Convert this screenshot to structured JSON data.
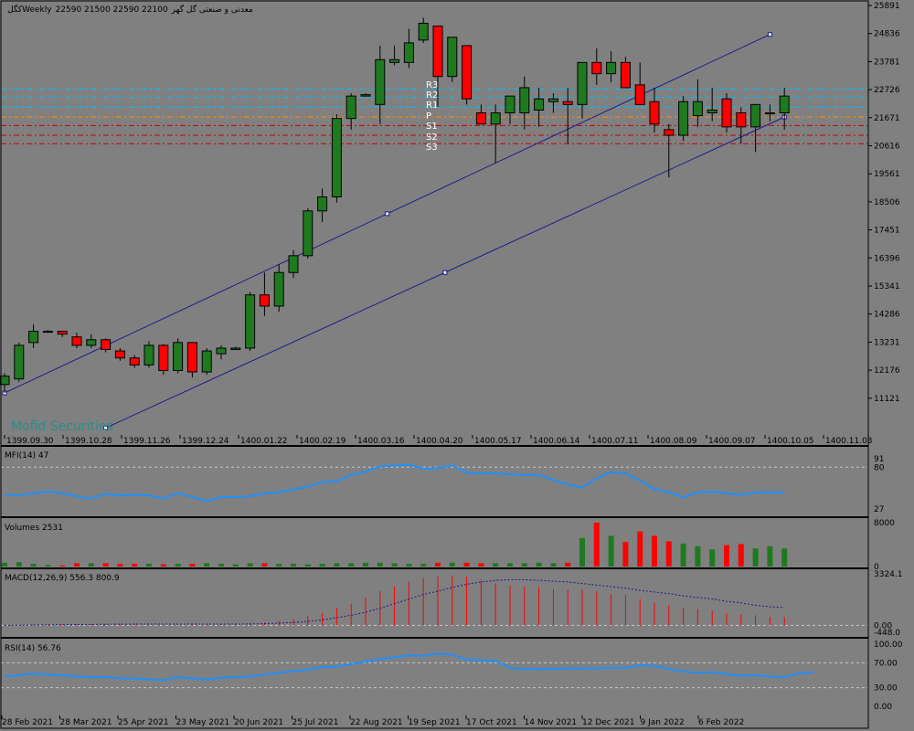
{
  "header": {
    "symbol": "کگل",
    "timeframe": "Weekly",
    "ohlc": "22590 21500 22590 22100",
    "description": "معدنی و صنعتی گل گهر"
  },
  "watermark": "Mofid Securities",
  "colors": {
    "background": "#808080",
    "bull": "#1F7A1F",
    "bear": "#FF0000",
    "channel": "#1A1A8C",
    "pivot_r": "#00BFFF",
    "pivot_s": "#CC0000",
    "pivot_p": "#FF8C00",
    "indicator": "#1E90FF",
    "text": "#000000",
    "pivot_text": "#FFFFFF"
  },
  "main_ticks": [
    "25891",
    "24836",
    "23781",
    "22726",
    "21671",
    "20616",
    "19561",
    "18506",
    "17451",
    "16396",
    "15341",
    "14286",
    "13231",
    "12176",
    "11121"
  ],
  "main_dates": [
    "1399.09.30",
    "1399.10.28",
    "1399.11.26",
    "1399.12.24",
    "1400.01.22",
    "1400.02.19",
    "1400.03.16",
    "1400.04.20",
    "1400.05.17",
    "1400.06.14",
    "1400.07.11",
    "1400.08.09",
    "1400.09.07",
    "1400.10.05",
    "1400.11.03"
  ],
  "bottom_dates": [
    "28 Feb 2021",
    "28 Mar 2021",
    "25 Apr 2021",
    "23 May 2021",
    "20 Jun 2021",
    "25 Jul 2021",
    "22 Aug 2021",
    "19 Sep 2021",
    "17 Oct 2021",
    "14 Nov 2021",
    "12 Dec 2021",
    "9 Jan 2022",
    "6 Feb 2022"
  ],
  "pivot_labels": [
    "R3",
    "R2",
    "R1",
    "P",
    "S1",
    "S2",
    "S3"
  ],
  "mfi": {
    "label": "MFI(14) 47",
    "ticks": [
      "91",
      "80",
      "27"
    ]
  },
  "volumes": {
    "label": "Volumes 2531",
    "ticks": [
      "8000",
      "0"
    ]
  },
  "macd": {
    "label": "MACD(12,26,9) 556.3 800.9",
    "ticks": [
      "3324.1",
      "0.00",
      "-448.0"
    ]
  },
  "rsi": {
    "label": "RSI(14) 56.76",
    "ticks": [
      "100.00",
      "70.00",
      "30.00",
      "0.00"
    ]
  },
  "chart_data": [
    {
      "type": "candlestick",
      "ylim": [
        10700,
        26100
      ],
      "candles": [
        [
          12500,
          12900,
          12200,
          12800
        ],
        [
          12700,
          14000,
          12600,
          13900
        ],
        [
          14000,
          14650,
          13800,
          14400
        ],
        [
          14400,
          14450,
          14350,
          14400
        ],
        [
          14400,
          14300,
          14200,
          14300
        ],
        [
          14200,
          14350,
          13800,
          13900
        ],
        [
          13900,
          14300,
          13800,
          14100
        ],
        [
          14100,
          14150,
          13650,
          13750
        ],
        [
          13700,
          13800,
          13350,
          13450
        ],
        [
          13450,
          13550,
          13100,
          13200
        ],
        [
          13200,
          14050,
          13100,
          13900
        ],
        [
          13900,
          13950,
          12850,
          13000
        ],
        [
          13000,
          14150,
          12900,
          14000
        ],
        [
          14000,
          14000,
          12750,
          12950
        ],
        [
          12950,
          13800,
          12850,
          13700
        ],
        [
          13600,
          13900,
          13400,
          13800
        ],
        [
          13750,
          13850,
          13750,
          13800
        ],
        [
          13800,
          15800,
          13700,
          15700
        ],
        [
          15700,
          16500,
          14950,
          15300
        ],
        [
          15300,
          16800,
          15100,
          16500
        ],
        [
          16500,
          17300,
          16300,
          17100
        ],
        [
          17100,
          18800,
          17000,
          18700
        ],
        [
          18700,
          19500,
          18300,
          19200
        ],
        [
          19200,
          22150,
          19000,
          22000
        ],
        [
          22000,
          22900,
          21600,
          22800
        ],
        [
          22800,
          22900,
          22800,
          22850
        ],
        [
          22500,
          24600,
          21800,
          24100
        ],
        [
          24000,
          24600,
          23900,
          24100
        ],
        [
          24000,
          25200,
          23800,
          24700
        ],
        [
          24800,
          25600,
          24700,
          25400
        ],
        [
          25300,
          25300,
          22400,
          23500
        ],
        [
          23500,
          24900,
          23300,
          24900
        ],
        [
          24600,
          24600,
          22500,
          22700
        ],
        [
          22200,
          22500,
          21900,
          21800
        ],
        [
          21800,
          22500,
          20400,
          22200
        ],
        [
          22200,
          22700,
          21800,
          22800
        ],
        [
          22200,
          23500,
          21600,
          23100
        ],
        [
          22300,
          23100,
          21700,
          22700
        ],
        [
          22600,
          22900,
          22200,
          22700
        ],
        [
          22600,
          23100,
          21100,
          22500
        ],
        [
          22500,
          24000,
          22000,
          24000
        ],
        [
          24000,
          24500,
          23200,
          23600
        ],
        [
          23600,
          24400,
          23300,
          24000
        ],
        [
          24000,
          24200,
          23300,
          23100
        ],
        [
          23200,
          24000,
          22600,
          22500
        ],
        [
          22600,
          23100,
          21500,
          21800
        ],
        [
          21600,
          21800,
          19900,
          21400
        ],
        [
          21400,
          22800,
          21200,
          22600
        ],
        [
          22100,
          23400,
          21700,
          22600
        ],
        [
          22200,
          23100,
          21900,
          22300
        ],
        [
          22700,
          22900,
          21500,
          21700
        ],
        [
          22200,
          22400,
          21100,
          21700
        ],
        [
          21700,
          22500,
          20800,
          22500
        ],
        [
          22200,
          22500,
          21900,
          22200
        ],
        [
          22200,
          23100,
          21600,
          22800
        ]
      ],
      "pivots": {
        "R3": 23050,
        "R2": 22750,
        "R1": 22400,
        "P": 22050,
        "S1": 21750,
        "S2": 21400,
        "S3": 21100
      },
      "channel_upper": [
        [
          0,
          12200
        ],
        [
          53,
          25000
        ]
      ],
      "channel_lower": [
        [
          7,
          10950
        ],
        [
          54,
          22050
        ]
      ]
    },
    {
      "type": "line",
      "name": "MFI(14)",
      "ylim": [
        20,
        100
      ],
      "values": [
        45,
        44,
        47,
        49,
        47,
        43,
        40,
        46,
        44,
        45,
        44,
        40,
        47,
        42,
        37,
        42,
        42,
        43,
        47,
        48,
        52,
        55,
        61,
        62,
        70,
        74,
        81,
        82,
        83,
        78,
        79,
        82,
        73,
        72,
        72,
        71,
        70,
        70,
        64,
        58,
        54,
        66,
        74,
        72,
        63,
        52,
        48,
        42,
        48,
        49,
        47,
        45,
        48,
        48,
        48
      ]
    },
    {
      "type": "bar",
      "name": "Volumes",
      "ylim": [
        0,
        8000
      ],
      "values": [
        700,
        800,
        500,
        300,
        200,
        600,
        600,
        600,
        500,
        500,
        500,
        400,
        500,
        500,
        600,
        500,
        400,
        600,
        600,
        500,
        500,
        400,
        500,
        600,
        600,
        700,
        700,
        600,
        500,
        500,
        700,
        700,
        700,
        600,
        600,
        600,
        600,
        700,
        600,
        700,
        5200,
        8000,
        5600,
        4500,
        6400,
        5600,
        4600,
        4200,
        3700,
        3100,
        3900,
        4100,
        3300,
        3700,
        3300
      ]
    },
    {
      "type": "bar",
      "name": "MACD(12,26,9)",
      "ylim": [
        -448,
        3324.1
      ],
      "values": [
        10,
        30,
        60,
        80,
        90,
        90,
        90,
        100,
        90,
        80,
        70,
        60,
        60,
        60,
        70,
        80,
        90,
        150,
        200,
        280,
        400,
        600,
        800,
        1100,
        1400,
        1800,
        2200,
        2500,
        2800,
        3050,
        3150,
        3200,
        3150,
        2950,
        2700,
        2550,
        2500,
        2450,
        2350,
        2300,
        2300,
        2200,
        2000,
        1950,
        1700,
        1450,
        1300,
        1150,
        1050,
        950,
        800,
        700,
        650,
        550,
        550
      ],
      "signal": [
        0,
        10,
        20,
        30,
        40,
        50,
        60,
        70,
        75,
        80,
        80,
        80,
        80,
        80,
        80,
        80,
        80,
        90,
        110,
        140,
        190,
        260,
        350,
        500,
        650,
        850,
        1100,
        1400,
        1700,
        2000,
        2200,
        2450,
        2650,
        2800,
        2900,
        2950,
        2950,
        2900,
        2850,
        2800,
        2700,
        2600,
        2500,
        2400,
        2250,
        2150,
        2050,
        1900,
        1800,
        1700,
        1550,
        1450,
        1300,
        1200,
        1150
      ]
    },
    {
      "type": "line",
      "name": "RSI(14)",
      "ylim": [
        0,
        100
      ],
      "values": [
        48,
        50,
        53,
        51,
        50,
        48,
        47,
        47,
        45,
        45,
        43,
        42,
        47,
        45,
        43,
        46,
        47,
        48,
        51,
        54,
        57,
        59,
        63,
        64,
        68,
        72,
        76,
        79,
        82,
        81,
        85,
        83,
        75,
        74,
        73,
        62,
        60,
        60,
        60,
        61,
        61,
        61,
        62,
        62,
        66,
        65,
        60,
        56,
        54,
        55,
        52,
        49,
        50,
        48,
        47,
        53,
        55
      ]
    }
  ]
}
